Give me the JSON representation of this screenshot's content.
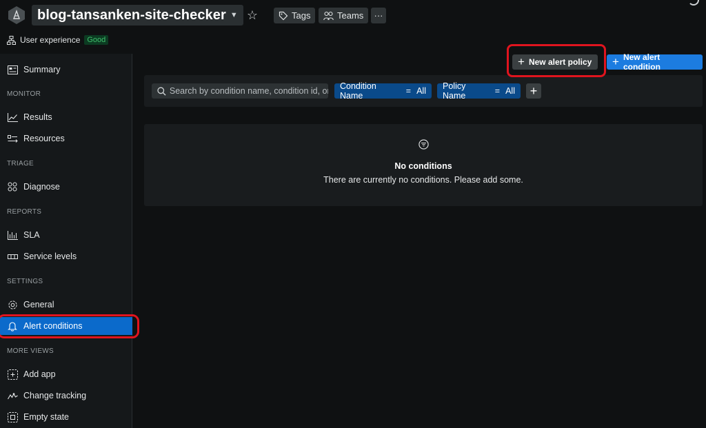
{
  "header": {
    "title": "blog-tansanken-site-checker",
    "tags_label": "Tags",
    "teams_label": "Teams",
    "more_label": "···",
    "ux_label": "User experience",
    "ux_status": "Good"
  },
  "sidebar": {
    "summary": "Summary",
    "sections": {
      "monitor": "MONITOR",
      "triage": "TRIAGE",
      "reports": "REPORTS",
      "settings": "SETTINGS",
      "more_views": "MORE VIEWS"
    },
    "items": {
      "results": "Results",
      "resources": "Resources",
      "diagnose": "Diagnose",
      "sla": "SLA",
      "service_levels": "Service levels",
      "general": "General",
      "alert_conditions": "Alert conditions",
      "add_app": "Add app",
      "change_tracking": "Change tracking",
      "empty_state": "Empty state"
    },
    "active_item": "Alert conditions"
  },
  "toolbar": {
    "new_policy_label": "New alert policy",
    "new_condition_label": "New alert condition"
  },
  "filters": {
    "search_placeholder": "Search by condition name, condition id, or policy",
    "condition_name_label": "Condition Name",
    "condition_name_value": "All",
    "policy_name_label": "Policy Name",
    "policy_name_value": "All",
    "equals": "="
  },
  "empty_state": {
    "title": "No conditions",
    "description": "There are currently no conditions. Please add some."
  },
  "colors": {
    "accent": "#0b6acb",
    "primary_button": "#1c7ce0",
    "filter_pill": "#0a4a8a",
    "good_badge": "#3fbf6c",
    "annotation": "#e0141e"
  }
}
